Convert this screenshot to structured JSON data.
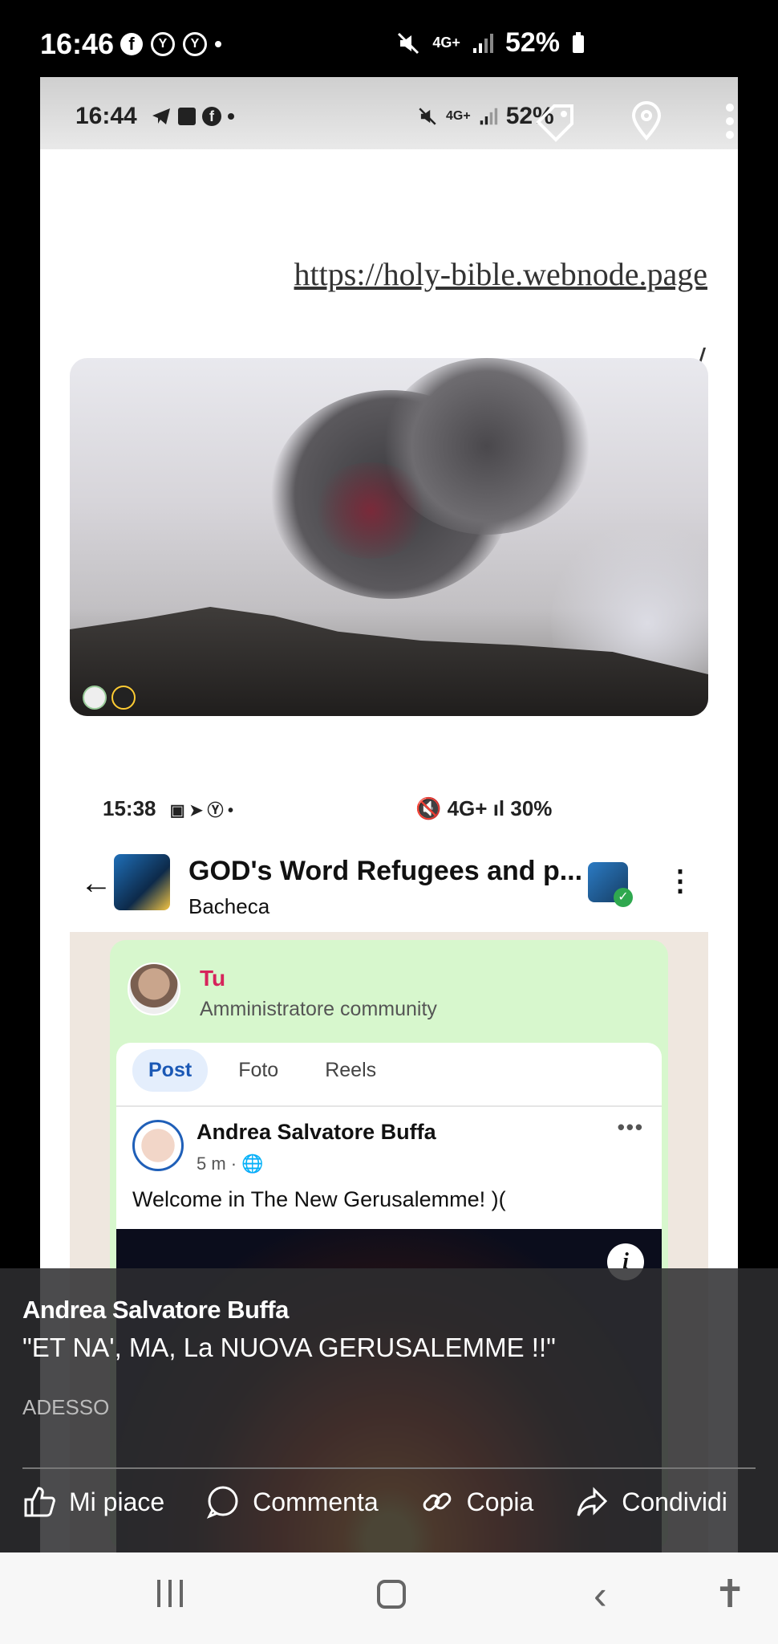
{
  "outer_status": {
    "time": "16:46",
    "battery": "52%"
  },
  "inner_status": {
    "time": "16:44",
    "battery": "52%"
  },
  "web": {
    "link": "https://holy-bible.webnode.page",
    "slash": "/"
  },
  "fb_screenshot": {
    "status_time": "15:38",
    "status_battery": "30%",
    "group_name": "GOD's Word  Refugees and p...",
    "group_sub": "Bacheca",
    "admin_name": "Tu",
    "admin_role": "Amministratore community",
    "tabs": [
      "Post",
      "Foto",
      "Reels"
    ],
    "post": {
      "author": "Andrea Salvatore Buffa",
      "time": "5 m ·",
      "text": "Welcome in The New Gerusalemme! )("
    }
  },
  "notification": {
    "sender": "Andrea Salvatore Buffa",
    "message": "\"ET NA', MA, La NUOVA GERUSALEMME !!\"",
    "when": "ADESSO",
    "actions": {
      "like": "Mi piace",
      "comment": "Commenta",
      "copy": "Copia",
      "share": "Condividi"
    }
  }
}
